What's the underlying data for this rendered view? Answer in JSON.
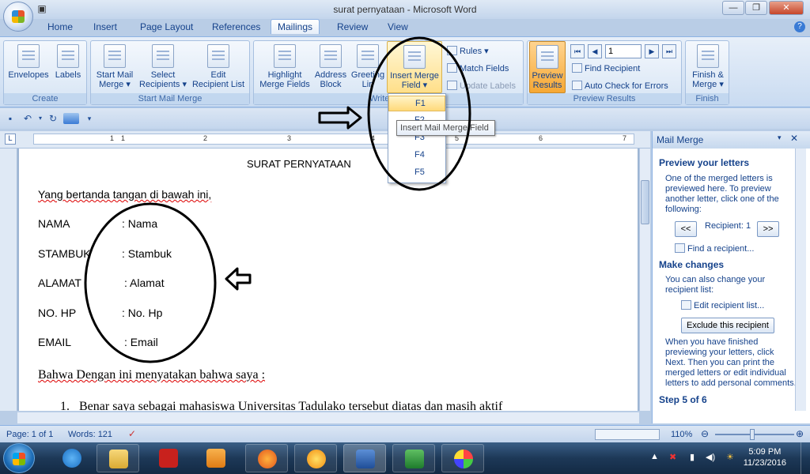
{
  "window": {
    "title": "surat pernyataan - Microsoft Word"
  },
  "tabs": [
    {
      "label": "Home"
    },
    {
      "label": "Insert"
    },
    {
      "label": "Page Layout"
    },
    {
      "label": "References"
    },
    {
      "label": "Mailings"
    },
    {
      "label": "Review"
    },
    {
      "label": "View"
    }
  ],
  "ribbon": {
    "create": {
      "label": "Create",
      "envelopes": "Envelopes",
      "labels": "Labels"
    },
    "start_mail_merge": {
      "label": "Start Mail Merge",
      "start_mail_merge_l1": "Start Mail",
      "start_mail_merge_l2": "Merge",
      "select_recipients_l1": "Select",
      "select_recipients_l2": "Recipients",
      "edit_recipient_l1": "Edit",
      "edit_recipient_l2": "Recipient List"
    },
    "write_insert": {
      "label": "Write & In",
      "highlight_l1": "Highlight",
      "highlight_l2": "Merge Fields",
      "address_l1": "Address",
      "address_l2": "Block",
      "greeting_l1": "Greeting",
      "greeting_l2": "Lin",
      "insert_merge_l1": "Insert Merge",
      "insert_merge_l2": "Field",
      "rules": "Rules",
      "match_fields": "Match Fields",
      "update_labels": "Update Labels"
    },
    "preview": {
      "label": "Preview Results",
      "preview_l1": "Preview",
      "preview_l2": "Results",
      "record": "1",
      "find_recipient": "Find Recipient",
      "auto_check": "Auto Check for Errors"
    },
    "finish": {
      "label": "Finish",
      "finish_l1": "Finish &",
      "finish_l2": "Merge"
    }
  },
  "dropdown": {
    "items": [
      "F1",
      "F2",
      "F3",
      "F4",
      "F5"
    ]
  },
  "tooltip": "Insert Mail Merge Field",
  "ruler": {
    "marks": [
      "1",
      "1",
      "2",
      "3",
      "4",
      "5",
      "6",
      "7"
    ]
  },
  "document": {
    "heading": "SURAT PERNYATAAN",
    "intro": "Yang bertanda tangan di bawah ini,",
    "fields": [
      {
        "label": "NAMA",
        "value": ": Nama"
      },
      {
        "label": "STAMBUK",
        "value": ": Stambuk"
      },
      {
        "label": "ALAMAT",
        "value": ": Alamat"
      },
      {
        "label": "NO. HP",
        "value": ": No. Hp"
      },
      {
        "label": "EMAIL",
        "value": ": Email"
      }
    ],
    "statement": "Bahwa Dengan ini menyatakan bahwa saya :",
    "list_item_num": "1.",
    "list_item": "Benar  saya sebagai mahasiswa Universitas Tadulako tersebut diatas dan masih aktif"
  },
  "task_pane": {
    "title": "Mail Merge",
    "preview_heading": "Preview your letters",
    "preview_text": [
      "One of the merged letters is",
      "previewed here. To preview",
      "another letter, click one of the",
      "following:"
    ],
    "prev_btn": "<<",
    "recipient": "Recipient: 1",
    "next_btn": ">>",
    "find_recipient": "Find a recipient...",
    "changes_heading": "Make changes",
    "changes_text": [
      "You can also change your",
      "recipient list:"
    ],
    "edit_list": "Edit recipient list...",
    "exclude_btn": "Exclude this recipient",
    "finish_text": [
      "When you have finished",
      "previewing your letters, click",
      "Next. Then you can print the",
      "merged letters or edit individual",
      "letters to add personal comments."
    ],
    "step": "Step 5 of 6"
  },
  "status": {
    "page": "Page: 1 of 1",
    "words": "Words: 121",
    "zoom": "110%"
  },
  "taskbar": {
    "time": "5:09 PM",
    "date": "11/23/2016",
    "apps": [
      "internet-explorer",
      "file-explorer",
      "pdf-reader",
      "media-player",
      "firefox",
      "game-app",
      "word",
      "excel",
      "paint"
    ]
  },
  "colors": {
    "accent": "#15428b",
    "ribbon": "#c9dbf1",
    "taskbar": "#1d3857"
  }
}
